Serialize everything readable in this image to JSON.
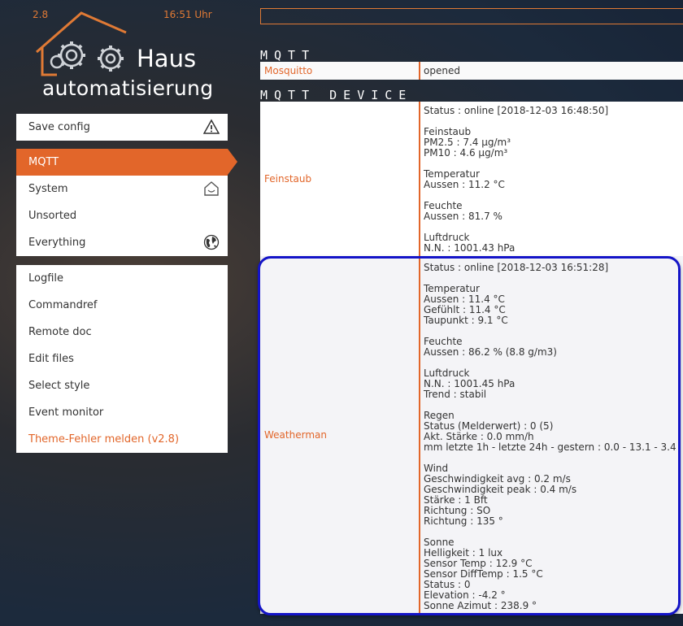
{
  "header": {
    "version": "2.8",
    "clock": "16:51 Uhr",
    "logo_line1": "Haus",
    "logo_line2": "automatisierung"
  },
  "menu_top": [
    {
      "label": "Save config",
      "icon": "warning-icon"
    }
  ],
  "menu_rooms": [
    {
      "label": "MQTT",
      "active": true
    },
    {
      "label": "System",
      "icon": "house-icon"
    },
    {
      "label": "Unsorted"
    },
    {
      "label": "Everything",
      "icon": "globe-icon"
    }
  ],
  "menu_tools": [
    {
      "label": "Logfile"
    },
    {
      "label": "Commandref"
    },
    {
      "label": "Remote doc"
    },
    {
      "label": "Edit files"
    },
    {
      "label": "Select style"
    },
    {
      "label": "Event monitor"
    },
    {
      "label": "Theme-Fehler melden (v2.8)"
    }
  ],
  "sections": {
    "mqtt": {
      "title": "MQTT",
      "rows": [
        {
          "name": "Mosquitto",
          "value": "opened"
        }
      ]
    },
    "mqtt_device": {
      "title": "MQTT_DEVICE",
      "rows": [
        {
          "name": "Feinstaub",
          "value": "Status : online [2018-12-03 16:48:50]\n\nFeinstaub\nPM2.5 : 7.4 µg/m³\nPM10 : 4.6 µg/m³\n\nTemperatur\nAussen : 11.2 °C\n\nFeuchte\nAussen : 81.7 %\n\nLuftdruck\nN.N. : 1001.43 hPa"
        },
        {
          "name": "Weatherman",
          "value": "Status : online [2018-12-03 16:51:28]\n\nTemperatur\nAussen : 11.4 °C\nGefühlt : 11.4 °C\nTaupunkt : 9.1 °C\n\nFeuchte\nAussen : 86.2 % (8.8 g/m3)\n\nLuftdruck\nN.N. : 1001.45 hPa\nTrend : stabil\n\nRegen\nStatus (Melderwert) : 0 (5)\nAkt. Stärke : 0.0 mm/h\nmm letzte 1h - letzte 24h - gestern : 0.0 - 13.1 - 3.4\n\nWind\nGeschwindigkeit avg : 0.2 m/s\nGeschwindigkeit peak : 0.4 m/s\nStärke : 1 Bft\nRichtung : SO\nRichtung : 135 °\n\nSonne\nHelligkeit : 1 lux\nSensor Temp : 12.9 °C\nSensor DiffTemp : 1.5 °C\nStatus : 0\nElevation : -4.2 °\nSonne Azimut : 238.9 °"
        }
      ]
    }
  },
  "colors": {
    "accent": "#e2662a",
    "highlight": "#1414c8"
  }
}
